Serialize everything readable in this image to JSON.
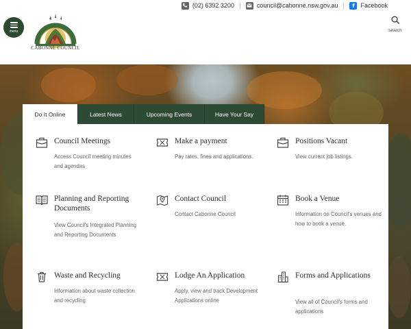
{
  "topbar": {
    "phone": "(02) 6392 3200",
    "email": "council@cabonne.nsw.gov.au",
    "facebook": "Facebook",
    "icons": [
      "phone-icon",
      "email-icon",
      "facebook-icon"
    ]
  },
  "header": {
    "menu_label": "menu",
    "logo_name": "CABONNE COUNCIL",
    "search_label": "search"
  },
  "tabs": [
    {
      "label": "Do It Online",
      "active": true
    },
    {
      "label": "Latest News",
      "active": false
    },
    {
      "label": "Upcoming Events",
      "active": false
    },
    {
      "label": "Have Your Say",
      "active": false
    }
  ],
  "cards": [
    {
      "title": "Council Meetings",
      "desc": "Access Council meeting minutes and agendas",
      "icon": "briefcase-icon"
    },
    {
      "title": "Make a payment",
      "desc": "Pay rates, fines and applications.",
      "icon": "ticket-icon"
    },
    {
      "title": "Positions Vacant",
      "desc": "View current job listings.",
      "icon": "briefcase-icon"
    },
    {
      "title": "Planning and Reporting Documents",
      "desc": "View Council's Integrated Planning and Reporting Documents",
      "icon": "open-book-icon"
    },
    {
      "title": "Contact Council",
      "desc": "Contact Cabonne Council",
      "icon": "map-pin-icon"
    },
    {
      "title": "Book a Venue",
      "desc": "Information on Council's venues and how to book a venue.",
      "icon": "calendar-icon"
    },
    {
      "title": "Waste and Recycling",
      "desc": "Information about waste collection and recycling",
      "icon": "trash-icon"
    },
    {
      "title": "Lodge An Application",
      "desc": "Apply, view and track Development Applications online",
      "icon": "ticket-icon"
    },
    {
      "title": "Forms and Applications",
      "desc": "View all of Council's forms and applications",
      "icon": "buildings-icon"
    }
  ],
  "colors": {
    "brand_green": "#2c4a34",
    "menu_green": "#2a4a32"
  }
}
